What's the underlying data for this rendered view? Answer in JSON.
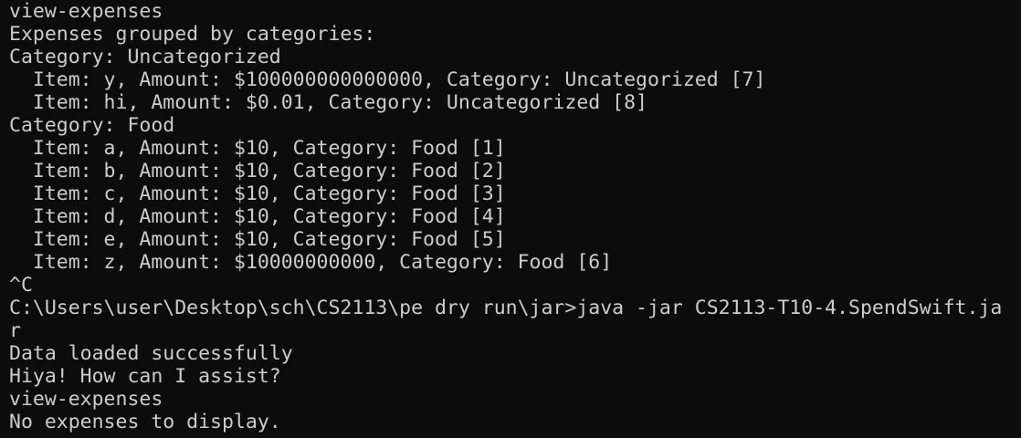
{
  "terminal": {
    "lines": [
      "view-expenses",
      "Expenses grouped by categories:",
      "Category: Uncategorized",
      "  Item: y, Amount: $100000000000000, Category: Uncategorized [7]",
      "  Item: hi, Amount: $0.01, Category: Uncategorized [8]",
      "Category: Food",
      "  Item: a, Amount: $10, Category: Food [1]",
      "  Item: b, Amount: $10, Category: Food [2]",
      "  Item: c, Amount: $10, Category: Food [3]",
      "  Item: d, Amount: $10, Category: Food [4]",
      "  Item: e, Amount: $10, Category: Food [5]",
      "  Item: z, Amount: $10000000000, Category: Food [6]",
      "^C",
      "C:\\Users\\user\\Desktop\\sch\\CS2113\\pe dry run\\jar>java -jar CS2113-T10-4.SpendSwift.ja",
      "r",
      "Data loaded successfully",
      "Hiya! How can I assist?",
      "view-expenses",
      "No expenses to display."
    ]
  },
  "colors": {
    "background": "#0c0c0c",
    "foreground": "#cccccc"
  }
}
